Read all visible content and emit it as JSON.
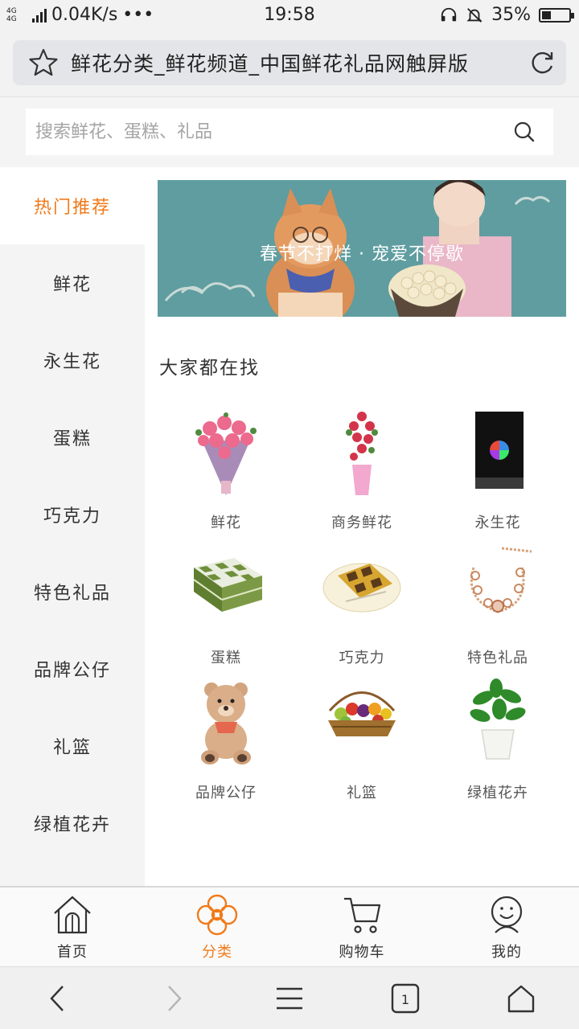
{
  "status_bar": {
    "network": "4G 4G",
    "speed": "0.04K/s",
    "more": "•••",
    "time": "19:58",
    "battery_percent": "35%",
    "battery_level": 0.35
  },
  "browser": {
    "page_title": "鲜花分类_鲜花频道_中国鲜花礼品网触屏版"
  },
  "search": {
    "placeholder": "搜索鲜花、蛋糕、礼品"
  },
  "sidebar": {
    "items": [
      {
        "label": "热门推荐",
        "active": true
      },
      {
        "label": "鲜花",
        "active": false
      },
      {
        "label": "永生花",
        "active": false
      },
      {
        "label": "蛋糕",
        "active": false
      },
      {
        "label": "巧克力",
        "active": false
      },
      {
        "label": "特色礼品",
        "active": false
      },
      {
        "label": "品牌公仔",
        "active": false
      },
      {
        "label": "礼篮",
        "active": false
      },
      {
        "label": "绿植花卉",
        "active": false
      }
    ]
  },
  "banner": {
    "caption": "春节不打烊 · 宠爱不停歇"
  },
  "section": {
    "title": "大家都在找"
  },
  "categories": [
    {
      "label": "鲜花",
      "icon": "rose-bouquet-image"
    },
    {
      "label": "商务鲜花",
      "icon": "business-flower-image"
    },
    {
      "label": "永生花",
      "icon": "preserved-flower-box-image"
    },
    {
      "label": "蛋糕",
      "icon": "checkered-cake-image"
    },
    {
      "label": "巧克力",
      "icon": "chocolate-box-image"
    },
    {
      "label": "特色礼品",
      "icon": "bracelet-image"
    },
    {
      "label": "品牌公仔",
      "icon": "teddy-bear-image"
    },
    {
      "label": "礼篮",
      "icon": "fruit-basket-image"
    },
    {
      "label": "绿植花卉",
      "icon": "potted-plant-image"
    }
  ],
  "tabbar": {
    "tabs": [
      {
        "label": "首页",
        "icon": "home-icon",
        "active": false
      },
      {
        "label": "分类",
        "icon": "category-flower-icon",
        "active": true
      },
      {
        "label": "购物车",
        "icon": "cart-icon",
        "active": false
      },
      {
        "label": "我的",
        "icon": "profile-icon",
        "active": false
      }
    ]
  },
  "browser_nav": {
    "tab_count": "1"
  },
  "colors": {
    "accent": "#f07a1a",
    "banner_bg": "#5f9da0",
    "sidebar_bg": "#f4f4f4"
  }
}
